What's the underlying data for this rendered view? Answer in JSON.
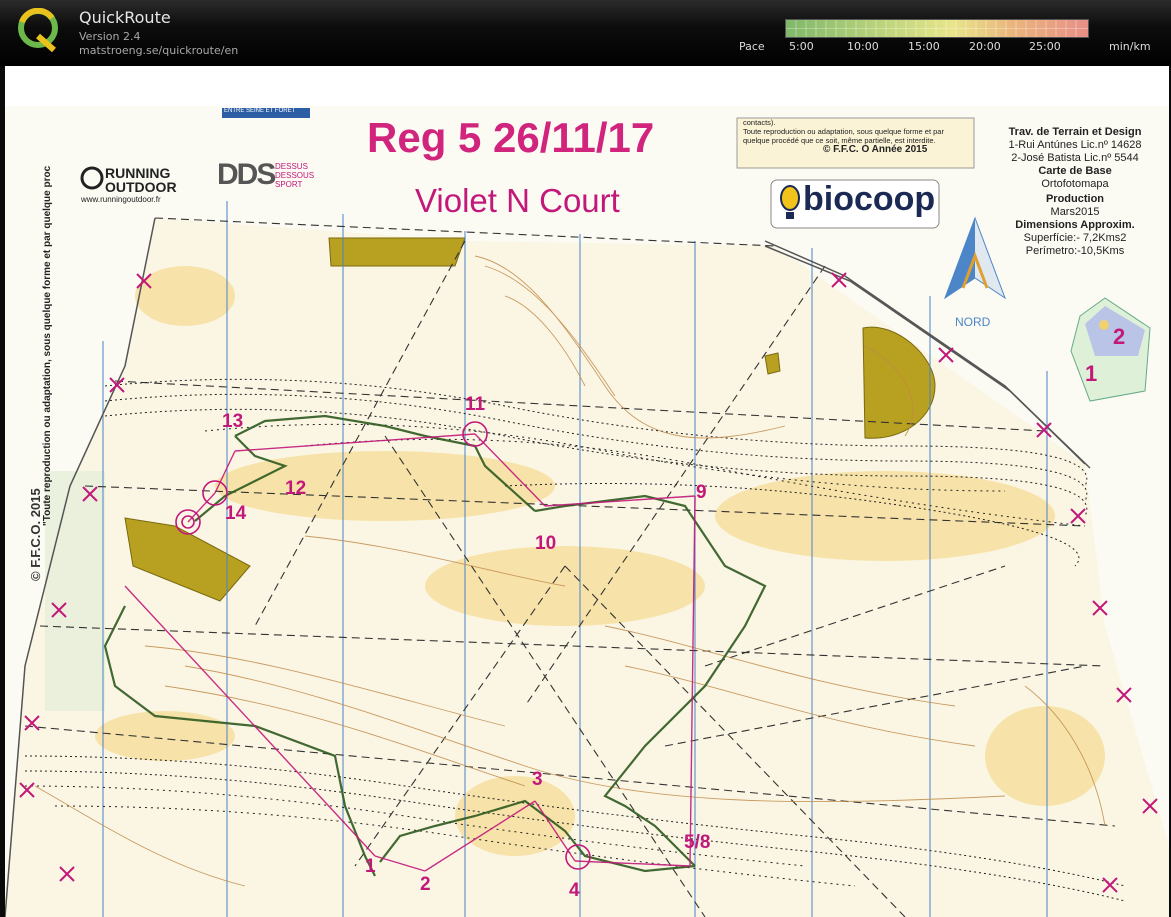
{
  "app": {
    "title": "QuickRoute",
    "version": "Version 2.4",
    "url": "matstroeng.se/quickroute/en"
  },
  "pace_scale": {
    "label": "Pace",
    "ticks": [
      "5:00",
      "10:00",
      "15:00",
      "20:00",
      "25:00"
    ],
    "unit": "min/km"
  },
  "map": {
    "title": "Reg 5  26/11/17",
    "course": "Violet N Court",
    "copyright_box": [
      "contacts).",
      "Toute reproduction ou adaptation, sous quelque forme et par",
      "quelque procédé que ce soit, même partielle, est interdite.",
      "© F.F.C. O Année 2015"
    ],
    "credits": {
      "survey_title": "Trav. de Terrain et Design",
      "survey_1": "1-Rui Antúnes Lic.nº 14628",
      "survey_2": "2-José Batista Lic.nº 5544",
      "base_title": "Carte de Base",
      "base_value": "Ortofotomapa",
      "production_title": "Production",
      "production_value": "Mars2015",
      "dimensions_title": "Dimensions Approxim.",
      "superficie": "Superfície:- 7,2Kms2",
      "perimetro": "Perímetro:-10,5Kms"
    },
    "north_label": "NORD",
    "inset_labels": [
      "2",
      "1"
    ],
    "side_text_1": "\"Toute reproduction ou adaptation, sous quelque forme et par quelque proc",
    "side_text_2": "© F.F.C.O. 2015",
    "sponsors": {
      "running_outdoor_1": "RUNNING",
      "running_outdoor_2": "OUTDOOR",
      "running_outdoor_url": "www.runningoutdoor.fr",
      "dds": "DDS",
      "dds_sub": [
        "DESSUS",
        "DESSOUS",
        "SPORT"
      ],
      "biocoop": "biocoop",
      "top_banner": "ENTRE SEINE ET FORÊT"
    },
    "controls": [
      "1",
      "2",
      "3",
      "4",
      "5/8",
      "9",
      "10",
      "11",
      "12",
      "13",
      "14"
    ]
  },
  "colors": {
    "course_magenta": "#c2187a",
    "route_green": "#2f5a1f",
    "meridian_blue": "#4d86c8",
    "open_land": "#f3d58a",
    "olive": "#b8a020"
  }
}
